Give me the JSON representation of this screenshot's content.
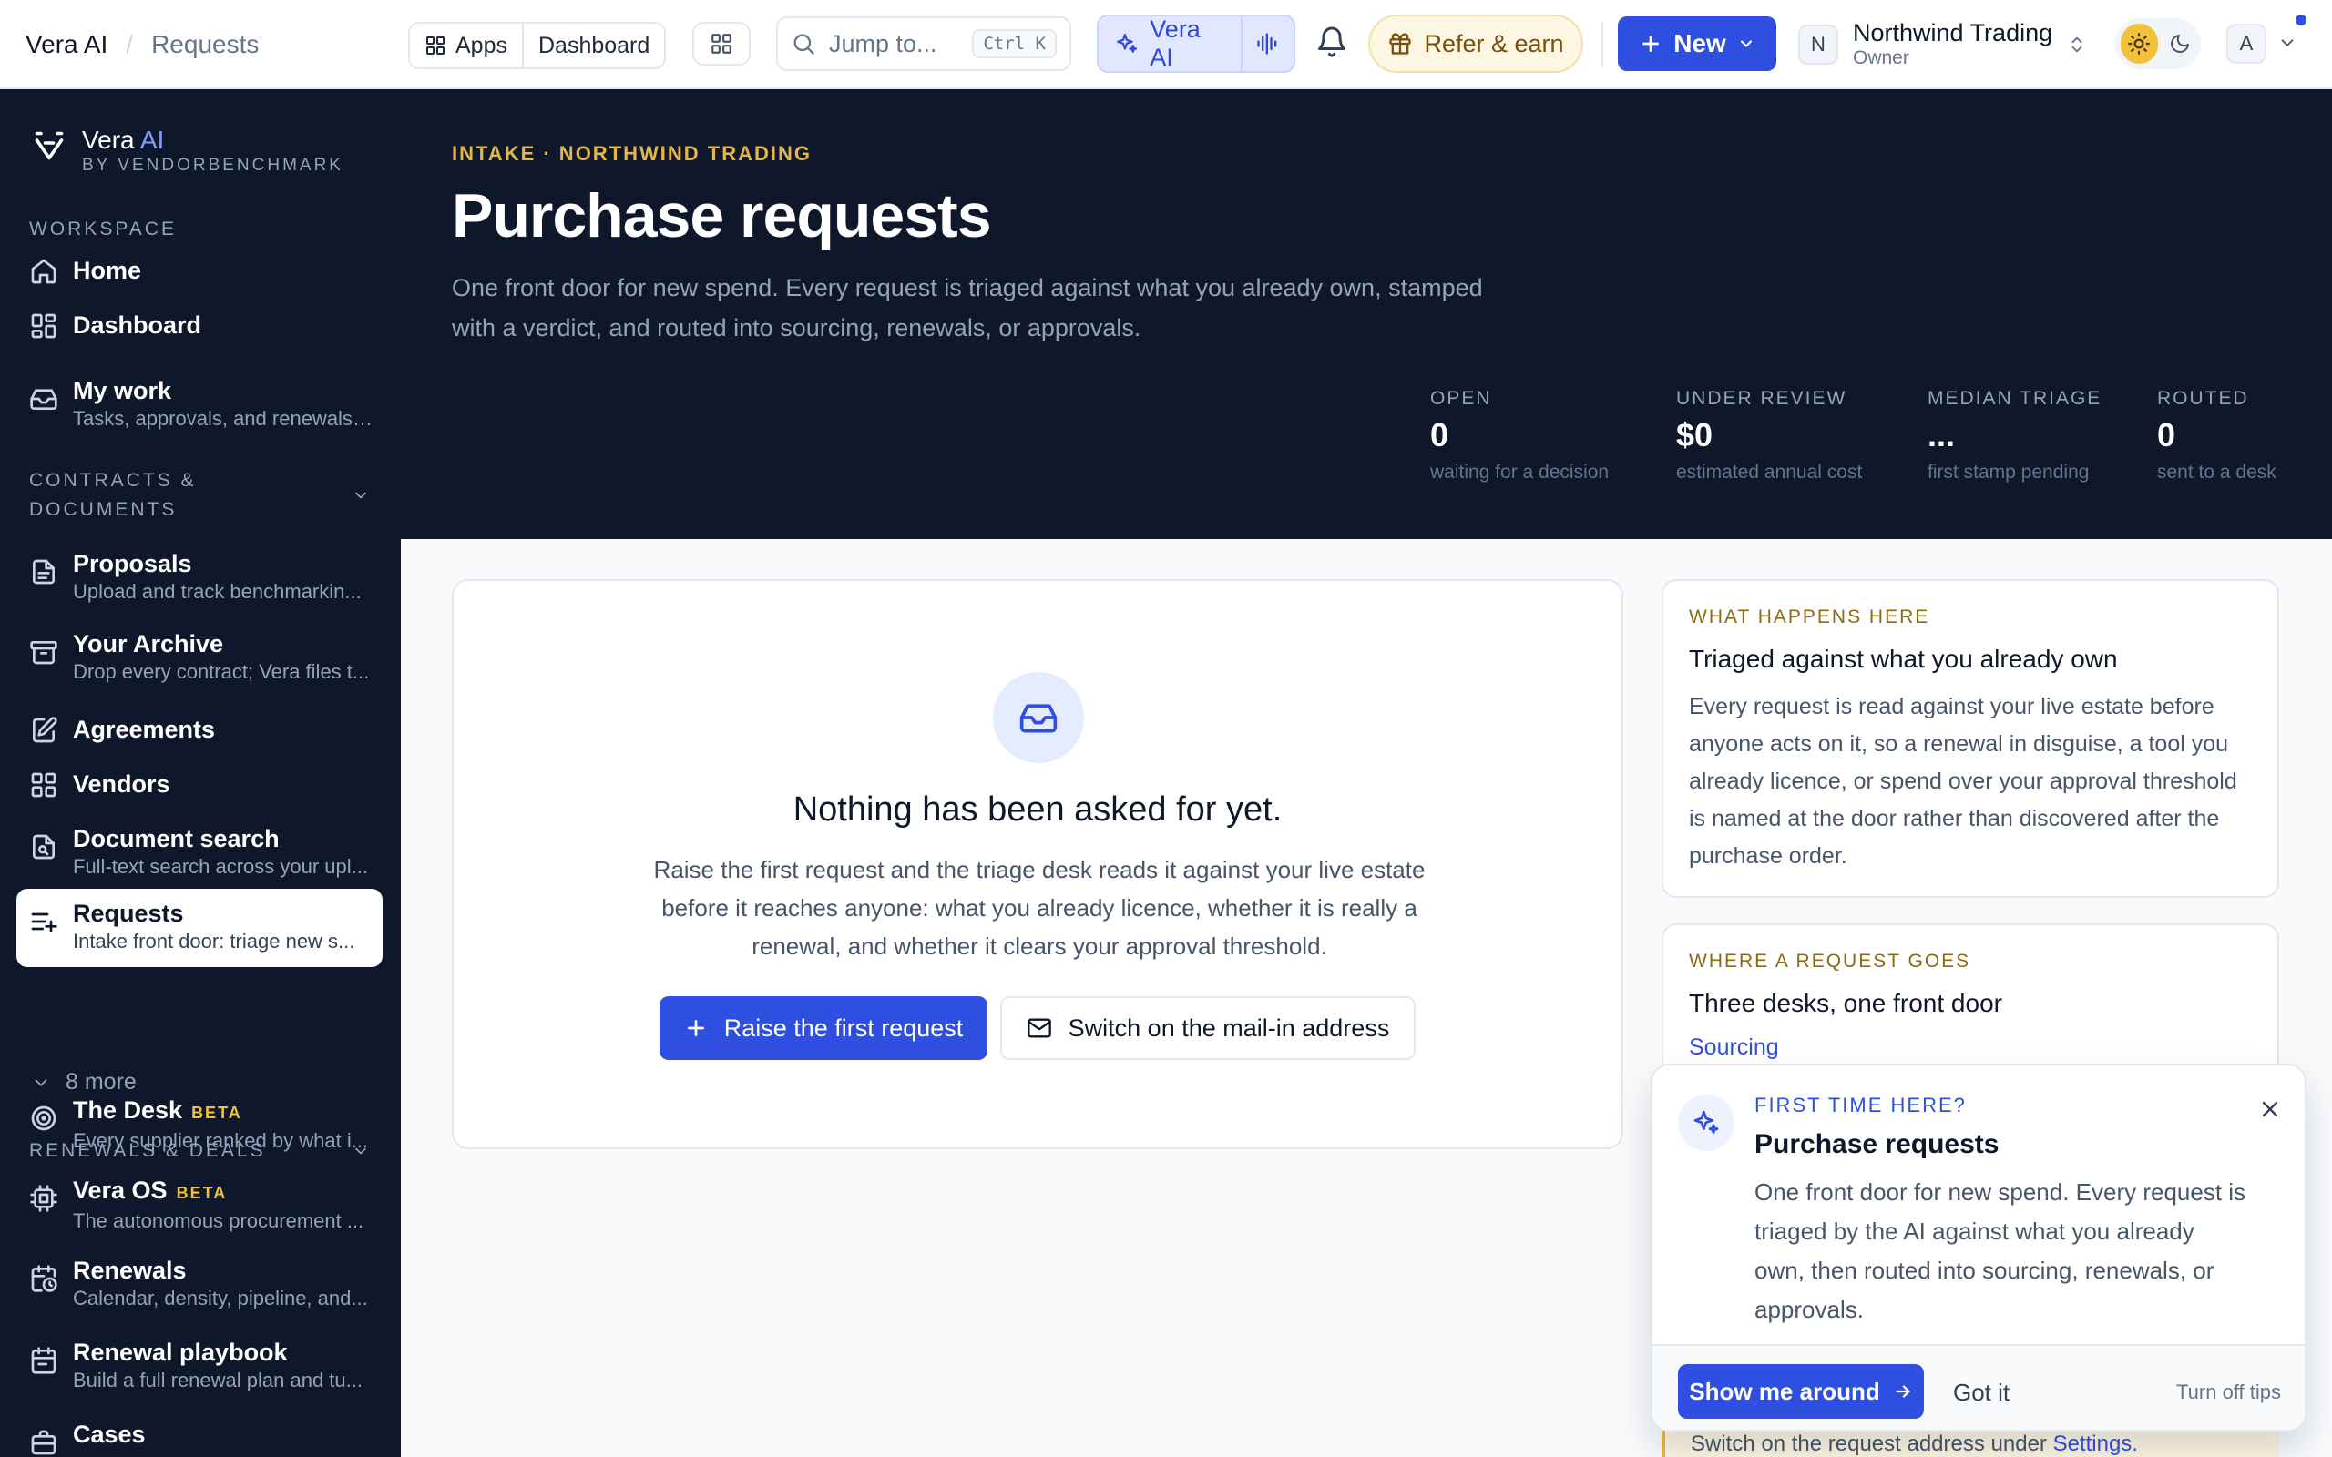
{
  "topbar": {
    "breadcrumb": [
      "Vera AI",
      "Requests"
    ],
    "apps_label": "Apps",
    "dashboard_label": "Dashboard",
    "search_placeholder": "Jump to...",
    "search_shortcut": "Ctrl K",
    "vera_label": "Vera AI",
    "refer_label": "Refer & earn",
    "new_label": "New",
    "org": {
      "initial": "N",
      "name": "Northwind Trading",
      "role": "Owner"
    },
    "user_initial": "A",
    "accent": "#2f4fe0"
  },
  "sidebar": {
    "brand": {
      "name": "Vera",
      "name_ai": "AI",
      "by": "BY VENDORBENCHMARK"
    },
    "sections": {
      "workspace": "WORKSPACE",
      "contracts": [
        "CONTRACTS &",
        "DOCUMENTS"
      ],
      "renewals": "RENEWALS & DEALS"
    },
    "items": [
      {
        "label": "Home",
        "icon": "home-icon"
      },
      {
        "label": "Dashboard",
        "icon": "dashboard-icon"
      },
      {
        "label": "My work",
        "sub": "Tasks, approvals, and renewals ...",
        "icon": "inbox-icon"
      },
      {
        "label": "Proposals",
        "sub": "Upload and track benchmarkin...",
        "icon": "document-icon"
      },
      {
        "label": "Your Archive",
        "sub": "Drop every contract; Vera files t...",
        "icon": "archive-icon"
      },
      {
        "label": "Agreements",
        "icon": "edit-document-icon"
      },
      {
        "label": "Vendors",
        "icon": "grid-icon"
      },
      {
        "label": "Document search",
        "sub": "Full-text search across your upl...",
        "icon": "document-search-icon"
      },
      {
        "label": "Requests",
        "sub": "Intake front door: triage new s...",
        "icon": "list-plus-icon"
      },
      {
        "label": "The Desk",
        "badge": "BETA",
        "sub": "Every supplier ranked by what i...",
        "icon": "target-icon"
      },
      {
        "label": "Vera OS",
        "badge": "BETA",
        "sub": "The autonomous procurement ...",
        "icon": "cpu-icon"
      },
      {
        "label": "Renewals",
        "sub": "Calendar, density, pipeline, and...",
        "icon": "calendar-clock-icon"
      },
      {
        "label": "Renewal playbook",
        "sub": "Build a full renewal plan and tu...",
        "icon": "calendar-icon"
      },
      {
        "label": "Cases",
        "sub": "",
        "icon": "briefcase-icon"
      }
    ],
    "more_label": "8 more"
  },
  "hero": {
    "eyebrow": "INTAKE · NORTHWIND TRADING",
    "title": "Purchase requests",
    "lead": "One front door for new spend. Every request is triaged against what you already own, stamped with a verdict, and routed into sourcing, renewals, or approvals.",
    "stats": [
      {
        "key": "OPEN",
        "value": "0",
        "sub": "waiting for a decision"
      },
      {
        "key": "UNDER REVIEW",
        "value": "$0",
        "sub": "estimated annual cost"
      },
      {
        "key": "MEDIAN TRIAGE",
        "value": "...",
        "sub": "first stamp pending"
      },
      {
        "key": "ROUTED",
        "value": "0",
        "sub": "sent to a desk"
      }
    ]
  },
  "empty": {
    "title": "Nothing has been asked for yet.",
    "body": "Raise the first request and the triage desk reads it against your live estate before it reaches anyone: what you already licence, whether it is really a renewal, and whether it clears your approval threshold.",
    "primary": "Raise the first request",
    "secondary": "Switch on the mail-in address"
  },
  "cards": {
    "what": {
      "kicker": "WHAT HAPPENS HERE",
      "title": "Triaged against what you already own",
      "body": "Every request is read against your live estate before anyone acts on it, so a renewal in disguise, a tool you already licence, or spend over your approval threshold is named at the door rather than discovered after the purchase order."
    },
    "where": {
      "kicker": "WHERE A REQUEST GOES",
      "title": "Three desks, one front door",
      "link": "Sourcing"
    },
    "note": {
      "text": "Switch on the request address under ",
      "link": "Settings."
    }
  },
  "tip": {
    "kicker": "FIRST TIME HERE?",
    "title": "Purchase requests",
    "body": "One front door for new spend. Every request is triaged by the AI against what you already own, then routed into sourcing, renewals, or approvals.",
    "primary": "Show me around",
    "secondary": "Got it",
    "off": "Turn off tips"
  }
}
